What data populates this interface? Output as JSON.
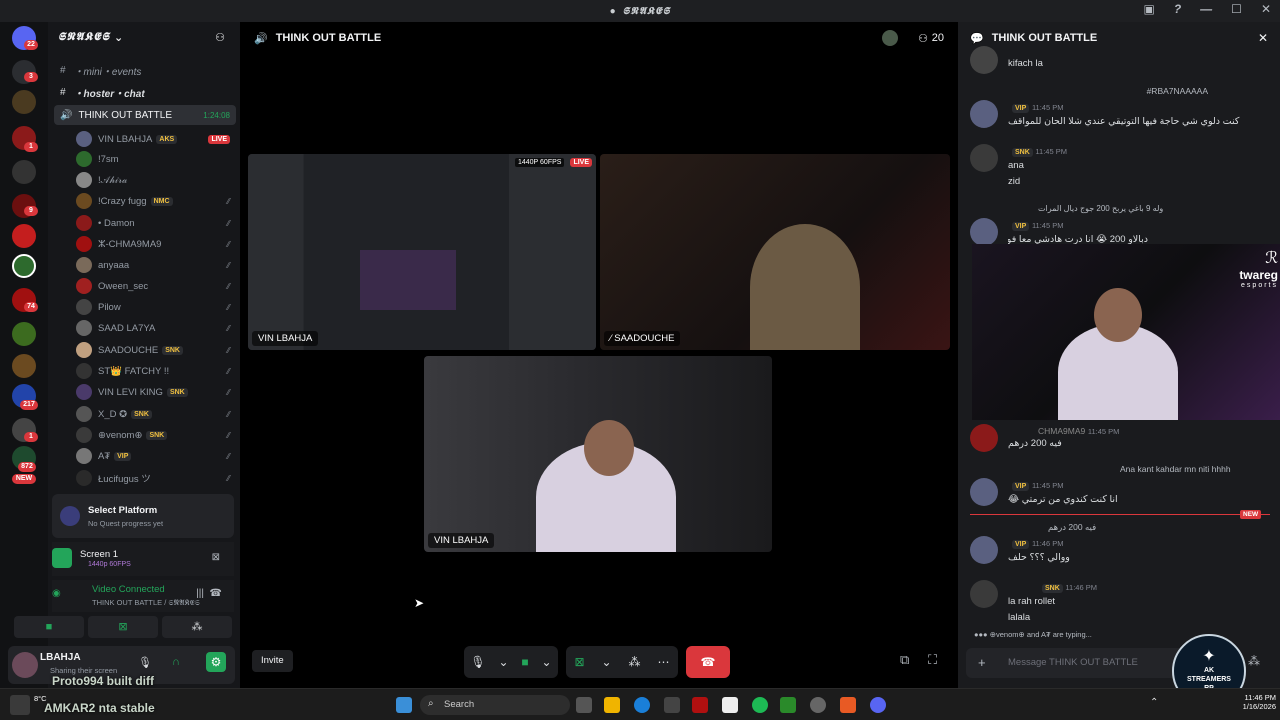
{
  "window": {
    "title": "𝕾𝕹𝕬𝕶𝕰𝕾"
  },
  "guilds": {
    "badges": [
      "22",
      "3",
      "1",
      "9",
      "74",
      "217",
      "1",
      "872"
    ],
    "new_label": "NEW"
  },
  "sidebar": {
    "server_name": "𝕾𝕹𝕬𝕶𝕰𝕾",
    "channels": [
      "・mini・events",
      "・hoster・chat"
    ],
    "voice_channel": {
      "name": "THINK OUT BATTLE",
      "timer": "1:24:08"
    },
    "members": [
      {
        "name": "VIN LBAHJA",
        "tag": "AKS",
        "live": "LIVE"
      },
      {
        "name": "!7sm",
        "tag": ""
      },
      {
        "name": "!𝒜𝒽𝒾𝓇𝒶",
        "tag": ""
      },
      {
        "name": "!Crazy fugg",
        "tag": "NMC"
      },
      {
        "name": "• Damon",
        "tag": ""
      },
      {
        "name": "ⵣ-CHMA9MA9",
        "tag": ""
      },
      {
        "name": "anyaaa",
        "tag": ""
      },
      {
        "name": "Oween_sec",
        "tag": ""
      },
      {
        "name": "Pilow",
        "tag": ""
      },
      {
        "name": "SAAD LA7YA",
        "tag": ""
      },
      {
        "name": "SAADOUCHE",
        "tag": "SNK"
      },
      {
        "name": "ST👑 FATCHY !!",
        "tag": ""
      },
      {
        "name": "VIN LEVI KING",
        "tag": "SNK"
      },
      {
        "name": "X_D ✪",
        "tag": "SNK"
      },
      {
        "name": "⊕venom⊕",
        "tag": "SNK"
      },
      {
        "name": "A₮",
        "tag": "VIP"
      },
      {
        "name": "Łucifugus ツ",
        "tag": ""
      }
    ]
  },
  "quest": {
    "title": "Select Platform",
    "subtitle": "No Quest progress yet"
  },
  "screen_share": {
    "title": "Screen 1",
    "quality": "1440p 60FPS"
  },
  "voice_status": {
    "status": "Video Connected",
    "channel": "THINK OUT BATTLE / 𝕾𝕹𝕬𝕶𝕰𝕾"
  },
  "user": {
    "name": "LBAHJA",
    "status": "Sharing their screen"
  },
  "overlay": {
    "line1": "Proto994  built diff",
    "line2": "AMKAR2  nta stable",
    "temp": "8°C"
  },
  "main": {
    "channel_title": "THINK OUT BATTLE",
    "participants": "20",
    "tiles": [
      {
        "label": "VIN LBAHJA",
        "badge": "1440P 60FPS",
        "live": "LIVE"
      },
      {
        "label": "SAADOUCHE"
      },
      {
        "label": "VIN LBAHJA"
      }
    ],
    "invite_label": "Invite"
  },
  "chat": {
    "title": "THINK OUT BATTLE",
    "messages": [
      {
        "text": "kifach la",
        "time": ""
      },
      {
        "reply": "#RBA7NAAAAA",
        "tag": "VIP",
        "time": "11:45 PM",
        "text": "كنت دلوي شي حاجة فيها التوتيقي عندي شلا الحان للمواقف"
      },
      {
        "tag": "SNK",
        "time": "11:45 PM",
        "text": "ana",
        "text2": "zid"
      },
      {
        "reply": "وله 9 باغي يربح 200 جوج ديال المرات",
        "tag": "VIP",
        "time": "11:45 PM",
        "text": "دبالاو 200 😭 انا درت هادشي معا فويتي"
      },
      {
        "author": "CHMA9MA9",
        "time": "11:45 PM",
        "text": "فيه 200 درهم"
      },
      {
        "reply": "Ana kant kahdar mn niti hhhh",
        "tag": "VIP",
        "time": "11:45 PM",
        "text": "انا كنت كندوي من ترمتي 😂"
      },
      {
        "reply": "فيه 200 درهم",
        "tag": "VIP",
        "time": "11:46 PM",
        "text": "ووالي ؟؟؟ حلف"
      },
      {
        "tag": "SNK",
        "time": "11:46 PM",
        "text": "la rah rollet",
        "text2": "lalala"
      }
    ],
    "new_label": "NEW",
    "typing": "⊕venom⊕ and A₮ are typing...",
    "input_placeholder": "Message THINK OUT BATTLE",
    "sponsor": "twareg",
    "sponsor_sub": "esports"
  },
  "taskbar": {
    "search": "Search",
    "time": "11:46 PM",
    "date": "1/16/2026",
    "logo": "AK STREAMERS RP"
  }
}
